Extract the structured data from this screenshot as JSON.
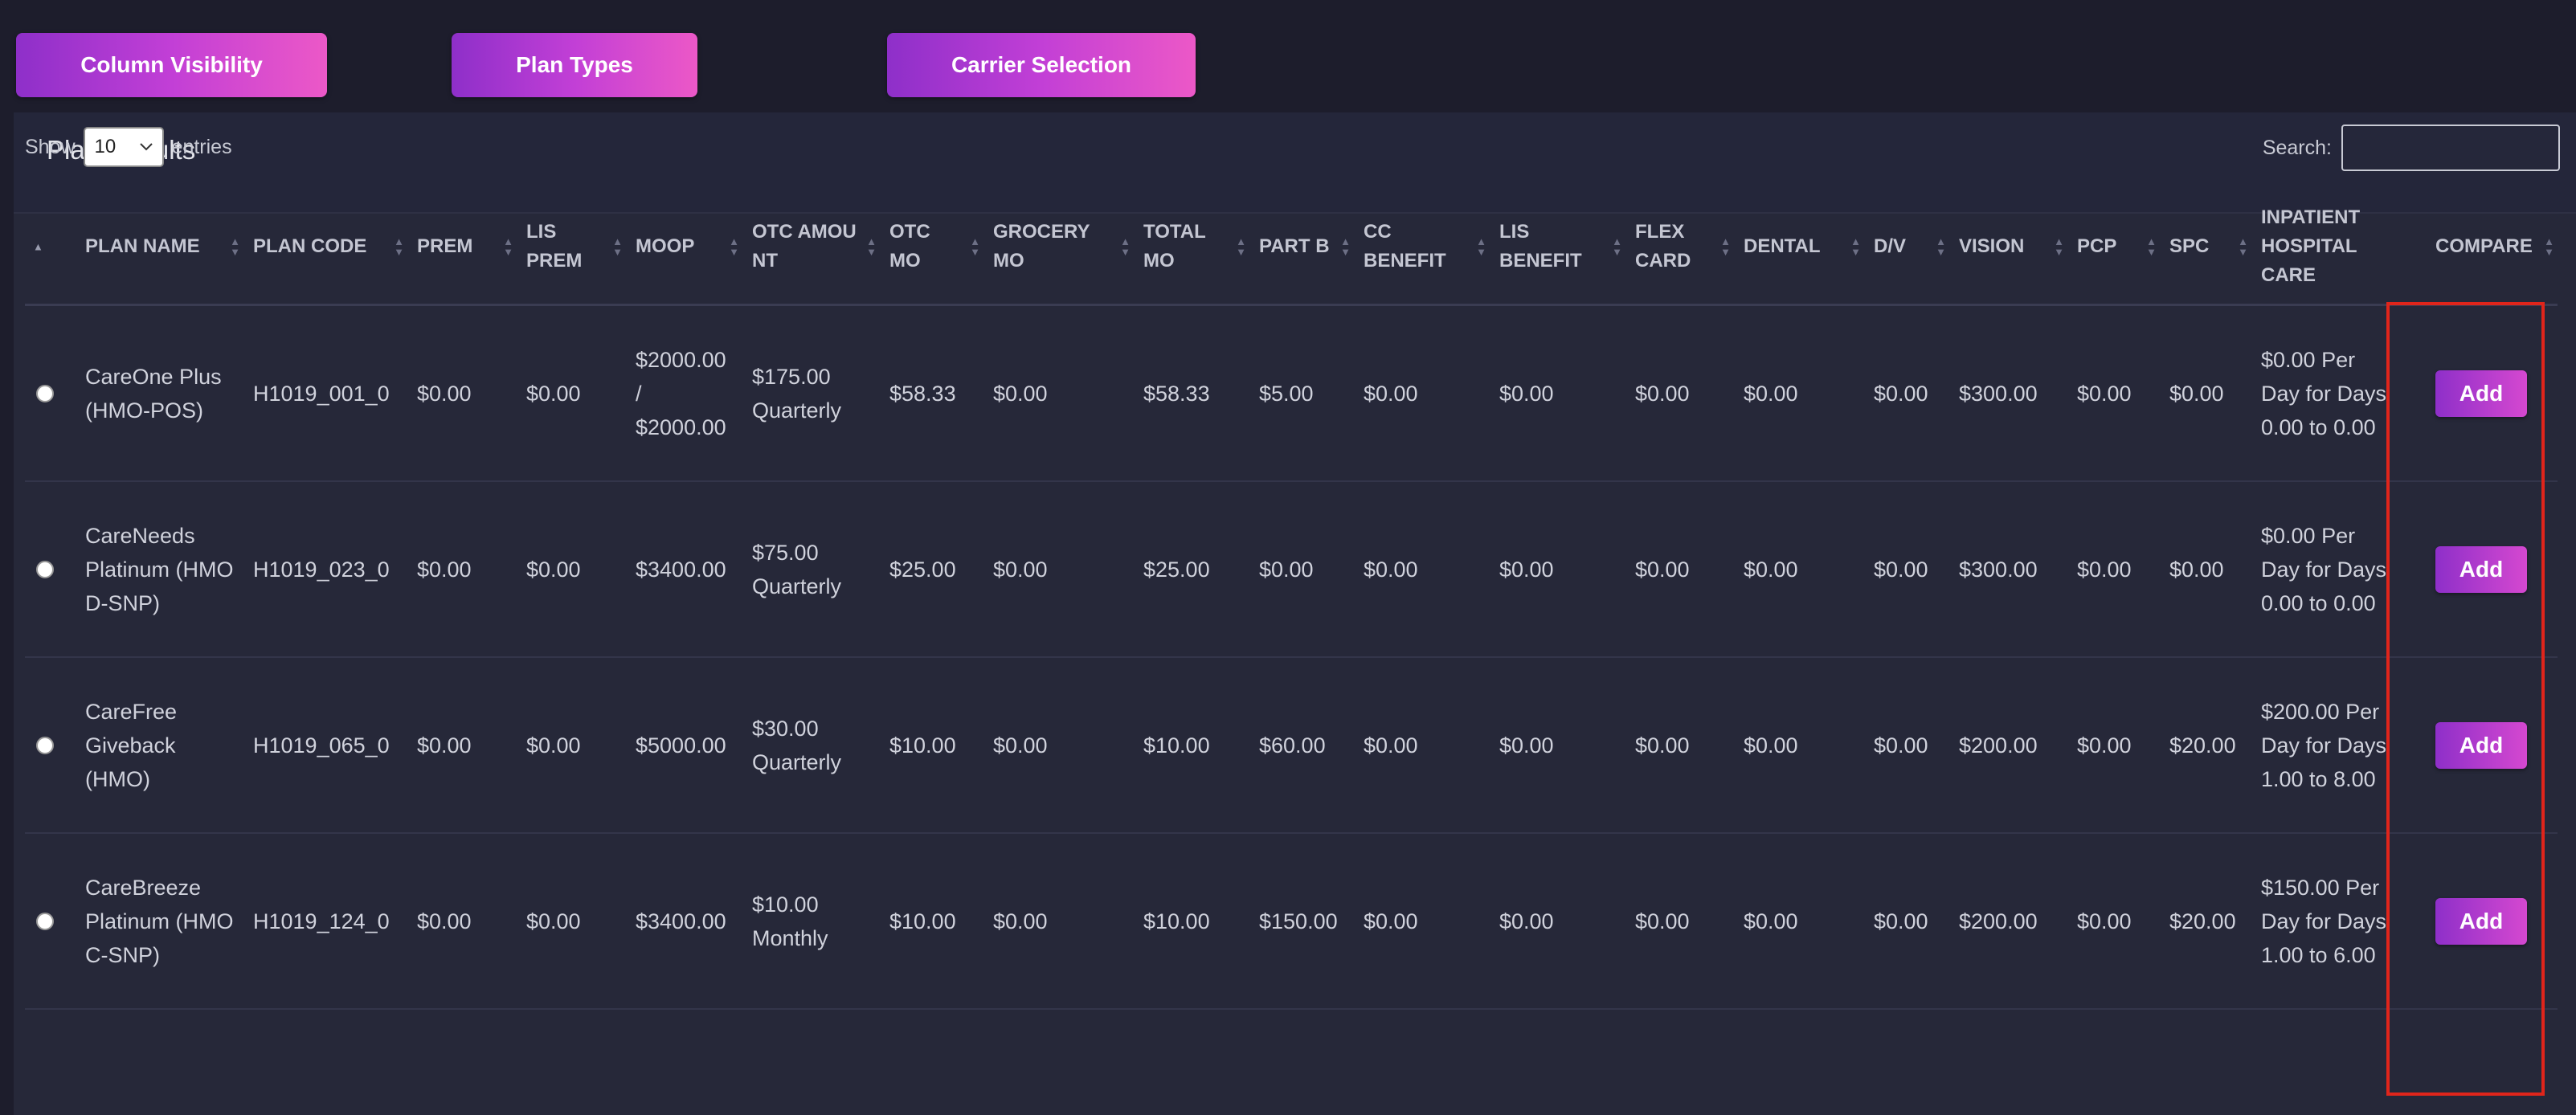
{
  "toolbar": {
    "column_visibility": "Column Visibility",
    "plan_types": "Plan Types",
    "carrier_selection": "Carrier Selection"
  },
  "panel": {
    "title": "Plan Results"
  },
  "entries": {
    "show_label": "Show",
    "value": "10",
    "suffix": "entries"
  },
  "search": {
    "label": "Search:",
    "value": ""
  },
  "table": {
    "headers": [
      "",
      "PLAN NAME",
      "PLAN CODE",
      "PREM",
      "LIS PREM",
      "MOOP",
      "OTC AMOUNT",
      "OTC MO",
      "GROCERY MO",
      "TOTAL MO",
      "PART B",
      "CC BENEFIT",
      "LIS BENEFIT",
      "FLEX CARD",
      "DENTAL",
      "D/V",
      "VISION",
      "PCP",
      "SPC",
      "INPATIENT HOSPITAL CARE",
      "COMPARE"
    ],
    "add_label": "Add",
    "rows": [
      [
        "",
        "CareOne Plus (HMO-POS)",
        "H1019_001_0",
        "$0.00",
        "$0.00",
        "$2000.00 / $2000.00",
        "$175.00 Quarterly",
        "$58.33",
        "$0.00",
        "$58.33",
        "$5.00",
        "$0.00",
        "$0.00",
        "$0.00",
        "$0.00",
        "$0.00",
        "$300.00",
        "$0.00",
        "$0.00",
        "$0.00 Per Day for Days 0.00 to 0.00"
      ],
      [
        "",
        "CareNeeds Platinum (HMO D-SNP)",
        "H1019_023_0",
        "$0.00",
        "$0.00",
        "$3400.00",
        "$75.00 Quarterly",
        "$25.00",
        "$0.00",
        "$25.00",
        "$0.00",
        "$0.00",
        "$0.00",
        "$0.00",
        "$0.00",
        "$0.00",
        "$300.00",
        "$0.00",
        "$0.00",
        "$0.00 Per Day for Days 0.00 to 0.00"
      ],
      [
        "",
        "CareFree Giveback (HMO)",
        "H1019_065_0",
        "$0.00",
        "$0.00",
        "$5000.00",
        "$30.00 Quarterly",
        "$10.00",
        "$0.00",
        "$10.00",
        "$60.00",
        "$0.00",
        "$0.00",
        "$0.00",
        "$0.00",
        "$0.00",
        "$200.00",
        "$0.00",
        "$20.00",
        "$200.00 Per Day for Days 1.00 to 8.00"
      ],
      [
        "",
        "CareBreeze Platinum (HMO C-SNP)",
        "H1019_124_0",
        "$0.00",
        "$0.00",
        "$3400.00",
        "$10.00 Monthly",
        "$10.00",
        "$0.00",
        "$10.00",
        "$150.00",
        "$0.00",
        "$0.00",
        "$0.00",
        "$0.00",
        "$0.00",
        "$200.00",
        "$0.00",
        "$20.00",
        "$150.00 Per Day for Days 1.00 to 6.00"
      ]
    ]
  },
  "colors": {
    "accent_start": "#8e2fc9",
    "accent_end": "#ec58c7",
    "highlight": "#e0251b",
    "panel_bg": "#262839"
  }
}
